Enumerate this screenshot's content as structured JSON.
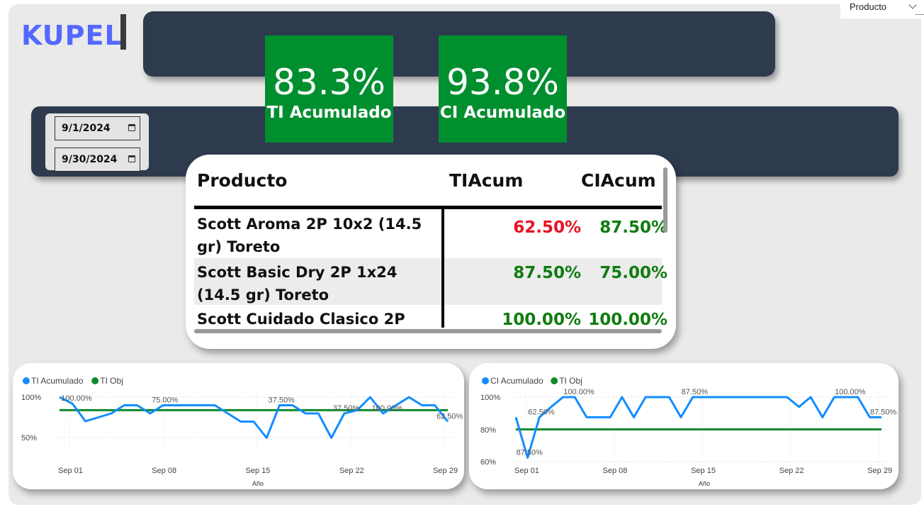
{
  "logo": "KUPEL",
  "filter": {
    "label": "Producto"
  },
  "kpis": [
    {
      "value": "83.3%",
      "label": "TI Acumulado"
    },
    {
      "value": "93.8%",
      "label": "CI Acumulado"
    }
  ],
  "dates": {
    "start": "9/1/2024",
    "end": "9/30/2024"
  },
  "table": {
    "headers": [
      "Producto",
      "TIAcum",
      "CIAcum"
    ],
    "rows": [
      {
        "name": "Scott Aroma 2P 10x2 (14.5 gr) Toreto",
        "ti": "62.50%",
        "ci": "87.50%",
        "ti_color": "#e81123",
        "ci_color": "#107c10"
      },
      {
        "name": "Scott Basic Dry 2P 1x24 (14.5 gr) Toreto",
        "ti": "87.50%",
        "ci": "75.00%",
        "ti_color": "#107c10",
        "ci_color": "#107c10"
      },
      {
        "name": "Scott Cuidado Clasico 2P",
        "ti": "100.00%",
        "ci": "100.00%",
        "ti_color": "#107c10",
        "ci_color": "#107c10"
      }
    ]
  },
  "chart_data": [
    {
      "type": "line",
      "legend": [
        "TI Acumulado",
        "TI Obj"
      ],
      "colors": {
        "actual": "#118dff",
        "target": "#108a2c"
      },
      "xlabel": "Año",
      "x_ticks": [
        "Sep 01",
        "Sep 08",
        "Sep 15",
        "Sep 22",
        "Sep 29"
      ],
      "y_ticks": [
        "100%",
        "50%"
      ],
      "ylim": [
        0.25,
        1.0
      ],
      "x": [
        1,
        2,
        3,
        4,
        5,
        6,
        7,
        8,
        9,
        10,
        11,
        12,
        13,
        14,
        15,
        16,
        17,
        18,
        19,
        20,
        21,
        22,
        23,
        24,
        25,
        26,
        27,
        28,
        29,
        30
      ],
      "series": [
        {
          "name": "TI Acumulado",
          "values": [
            1.0,
            0.9,
            0.63,
            0.69,
            0.75,
            0.875,
            0.875,
            0.75,
            0.875,
            0.875,
            0.875,
            0.875,
            0.875,
            0.75,
            0.625,
            0.625,
            0.375,
            0.875,
            0.875,
            0.75,
            0.75,
            0.375,
            0.75,
            0.8,
            1.0,
            0.75,
            0.875,
            1.0,
            0.875,
            0.875,
            0.625
          ]
        },
        {
          "name": "TI Obj",
          "values": [
            0.8,
            0.8
          ]
        }
      ],
      "labels": [
        {
          "i": 1,
          "text": "100.00%"
        },
        {
          "i": 8,
          "text": "75.00%"
        },
        {
          "i": 17,
          "text": "37.50%"
        },
        {
          "i": 22,
          "text": "37.50%"
        },
        {
          "i": 25,
          "text": "100.00%"
        },
        {
          "i": 31,
          "text": "62.50%"
        }
      ]
    },
    {
      "type": "line",
      "legend": [
        "CI Acumulado",
        "TI Obj"
      ],
      "colors": {
        "actual": "#118dff",
        "target": "#108a2c"
      },
      "xlabel": "Año",
      "x_ticks": [
        "Sep 01",
        "Sep 08",
        "Sep 15",
        "Sep 22",
        "Sep 29"
      ],
      "y_ticks": [
        "100%",
        "80%",
        "60%"
      ],
      "ylim": [
        0.6,
        1.0
      ],
      "series": [
        {
          "name": "CI Acumulado",
          "values": [
            0.875,
            0.625,
            0.875,
            0.94,
            1.0,
            1.0,
            0.875,
            0.875,
            0.875,
            1.0,
            0.875,
            1.0,
            1.0,
            1.0,
            0.875,
            1.0,
            1.0,
            1.0,
            1.0,
            1.0,
            1.0,
            1.0,
            1.0,
            1.0,
            0.94,
            1.0,
            0.875,
            1.0,
            1.0,
            1.0,
            0.875,
            0.875
          ]
        },
        {
          "name": "TI Obj",
          "values": [
            0.8,
            0.8
          ]
        }
      ],
      "labels": [
        {
          "i": 1,
          "text": "87.50%"
        },
        {
          "i": 2,
          "text": "62.50%"
        },
        {
          "i": 5,
          "text": "100.00%"
        },
        {
          "i": 15,
          "text": "87.50%"
        },
        {
          "i": 28,
          "text": "100.00%"
        },
        {
          "i": 31,
          "text": "87.50%"
        }
      ]
    }
  ]
}
